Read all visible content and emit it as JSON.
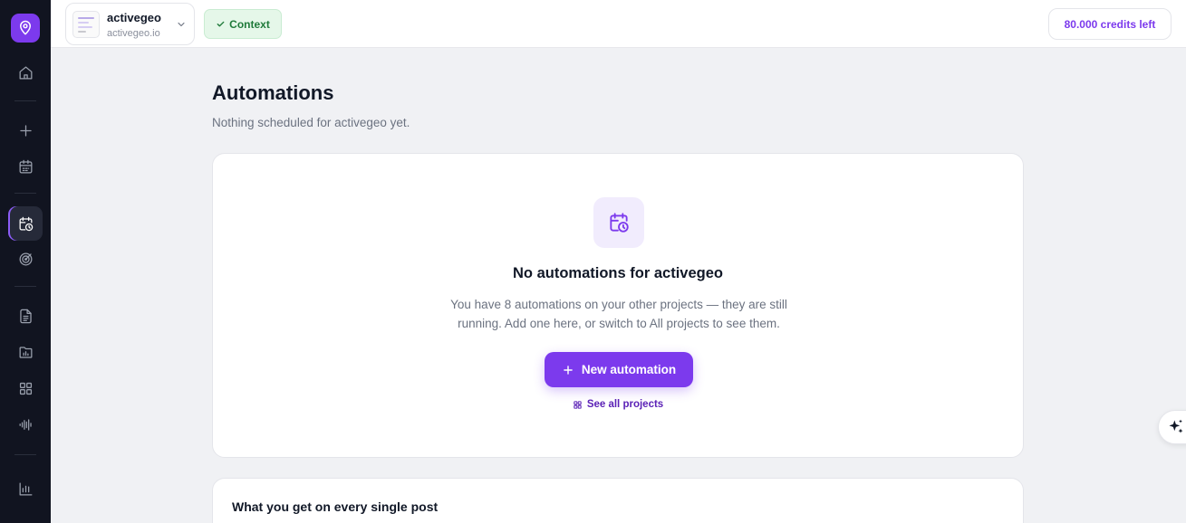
{
  "sidebar": {
    "logo_icon": "location-pin-icon",
    "items": [
      {
        "icon": "home-icon"
      },
      {
        "icon": "plus-icon"
      },
      {
        "icon": "calendar-icon"
      },
      {
        "icon": "calendar-clock-icon",
        "active": true
      },
      {
        "icon": "target-icon"
      },
      {
        "icon": "document-icon"
      },
      {
        "icon": "folder-chart-icon"
      },
      {
        "icon": "grid-icon"
      },
      {
        "icon": "audio-wave-icon"
      },
      {
        "icon": "bar-chart-icon"
      }
    ]
  },
  "topbar": {
    "project": {
      "name": "activegeo",
      "domain": "activegeo.io"
    },
    "context_label": "Context",
    "credits_label": "80.000 credits left"
  },
  "main": {
    "title": "Automations",
    "subtitle": "Nothing scheduled for activegeo yet.",
    "empty_state": {
      "title": "No automations for activegeo",
      "description": "You have 8 automations on your other projects — they are still running. Add one here, or switch to All projects to see them.",
      "primary_button": "New automation",
      "secondary_link": "See all projects"
    },
    "benefits": {
      "title": "What you get on every single post"
    }
  },
  "colors": {
    "accent": "#7c3aed",
    "sidebar_bg": "#111420",
    "context_green": "#1f7a3a",
    "page_bg": "#f0f1f4"
  }
}
